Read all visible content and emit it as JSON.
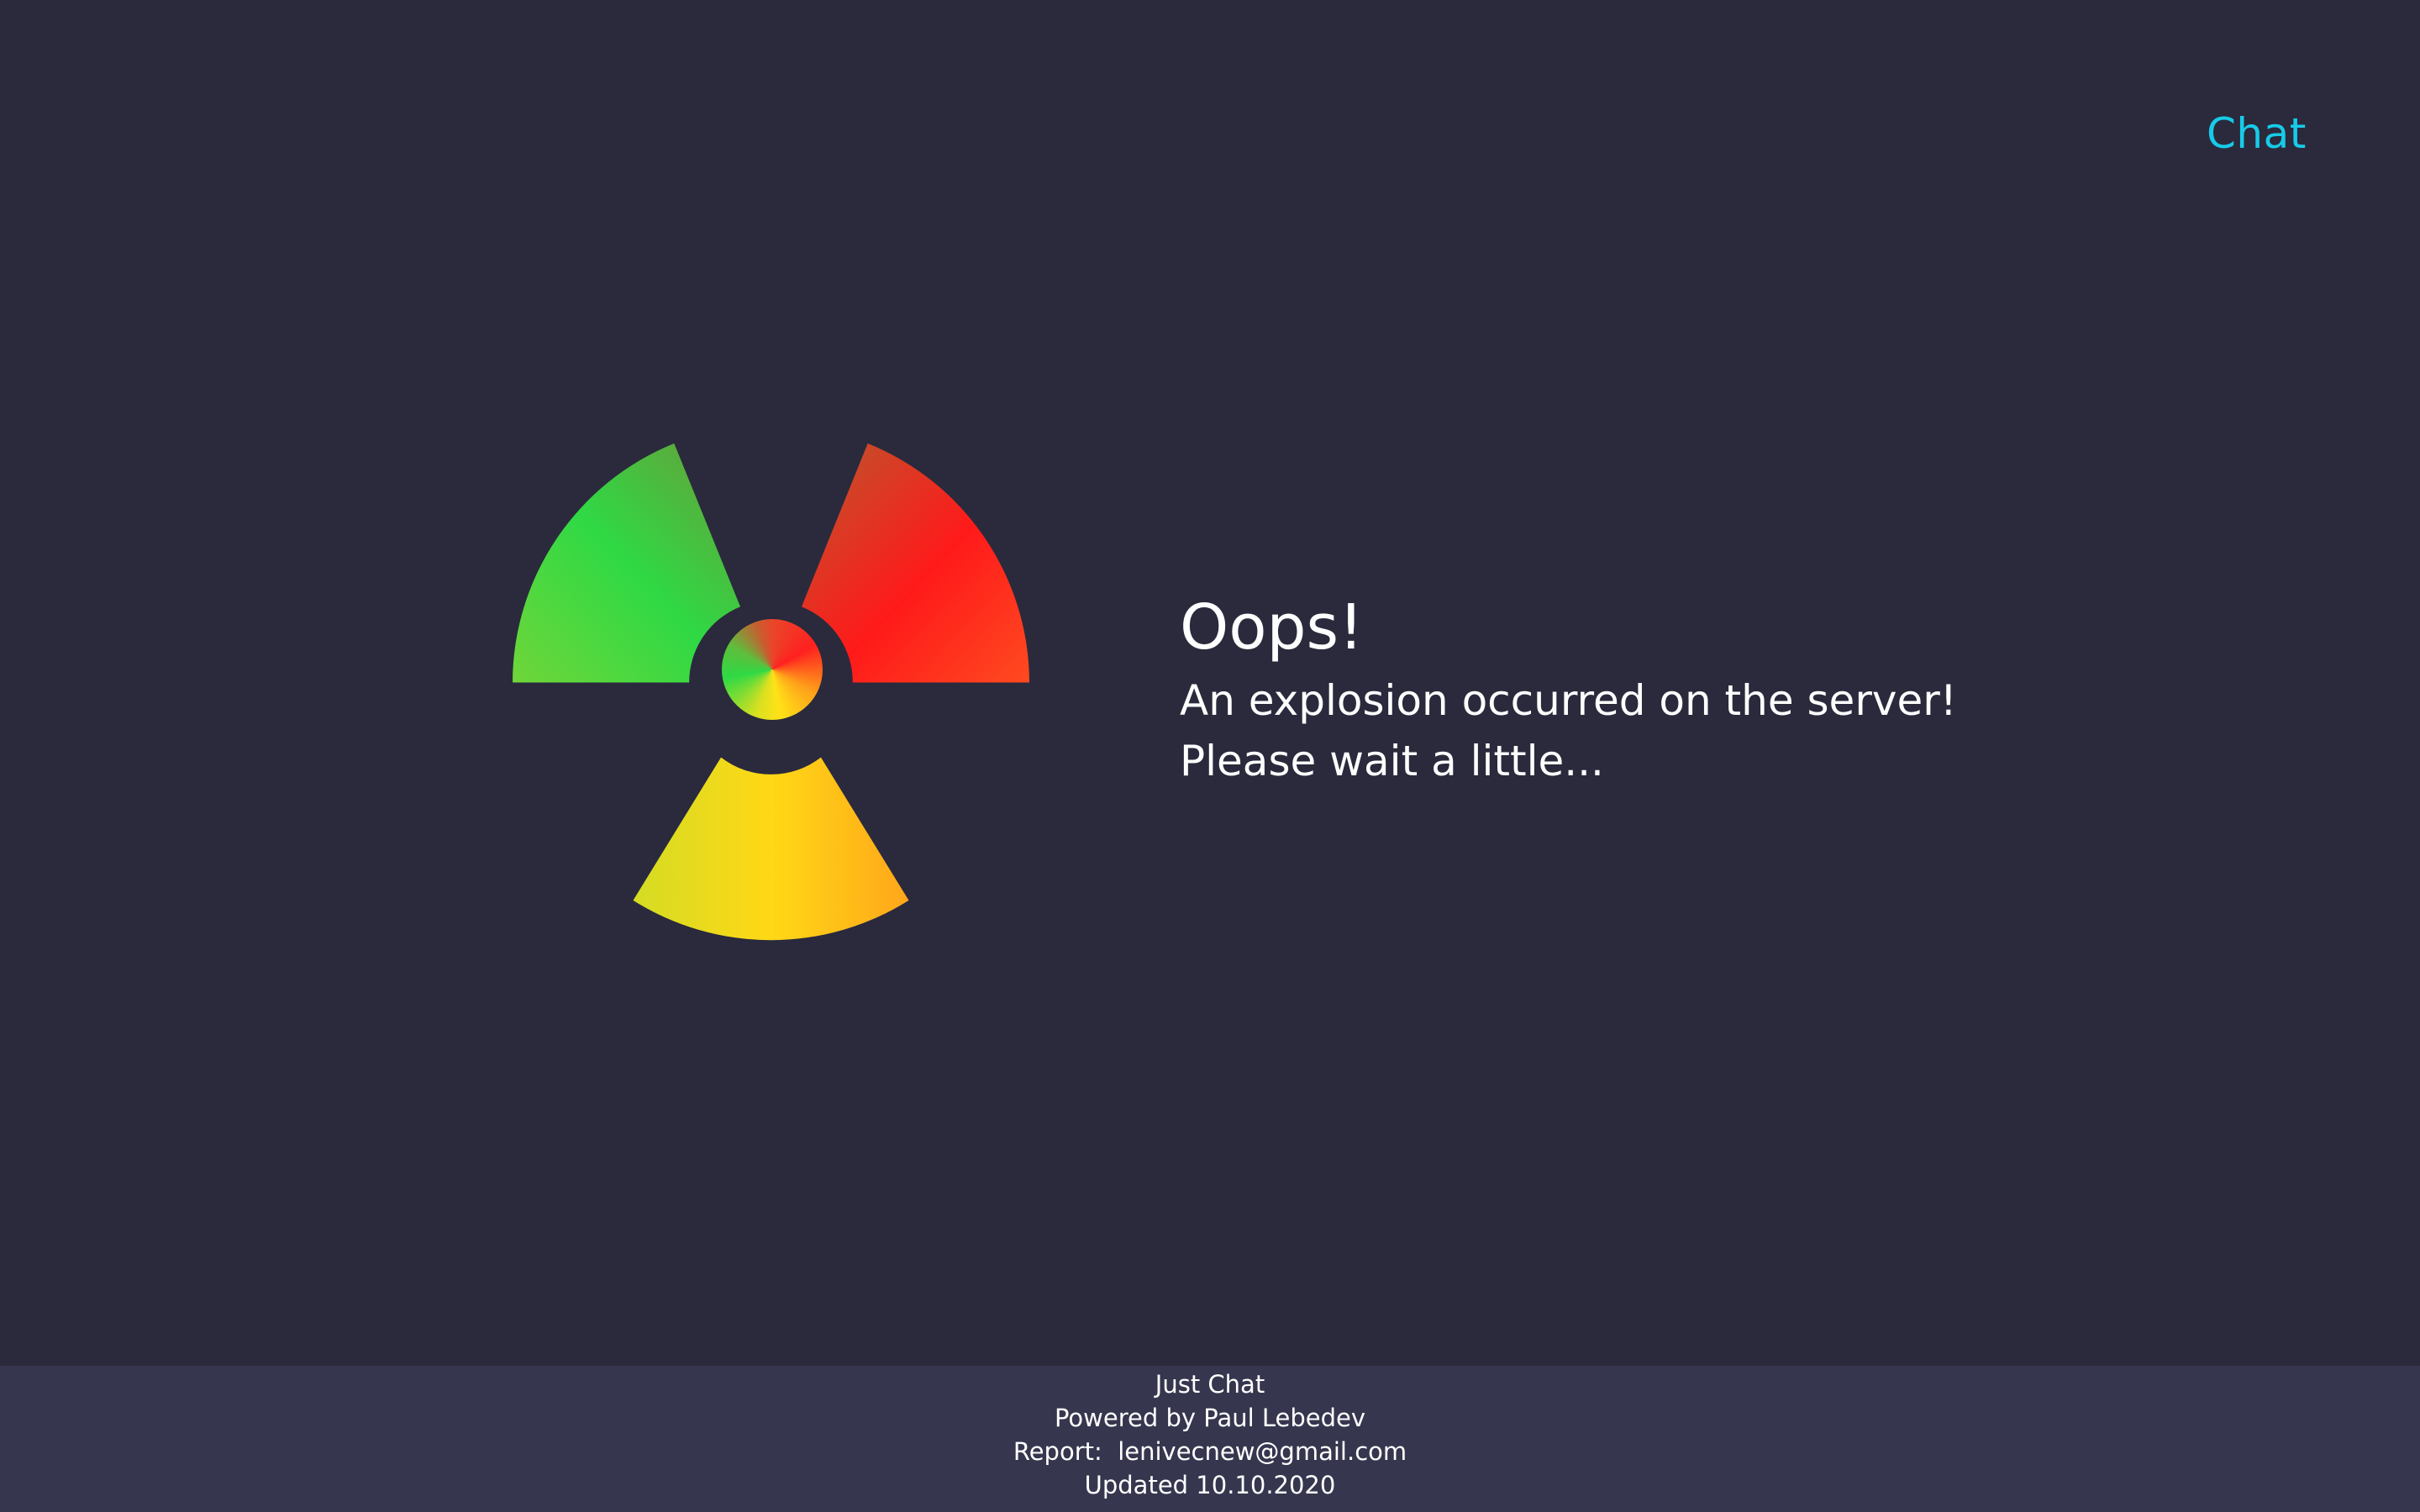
{
  "header": {
    "chat_link": "Chat"
  },
  "error": {
    "title": "Oops!",
    "line1": "An explosion occurred on the server!",
    "line2": "Please wait a little..."
  },
  "icon": {
    "name": "radiation-hazard-icon"
  },
  "footer": {
    "app_name": "Just Chat",
    "powered_by": "Powered by Paul Lebedev",
    "report_label": "Report:",
    "report_email": "lenivecnew@gmail.com",
    "updated": "Updated 10.10.2020"
  },
  "colors": {
    "background": "#2a2a3c",
    "footer_background": "#36364f",
    "link": "#17cbe9",
    "green": "#2fd944",
    "red": "#ff2020",
    "yellow": "#ffe217"
  }
}
